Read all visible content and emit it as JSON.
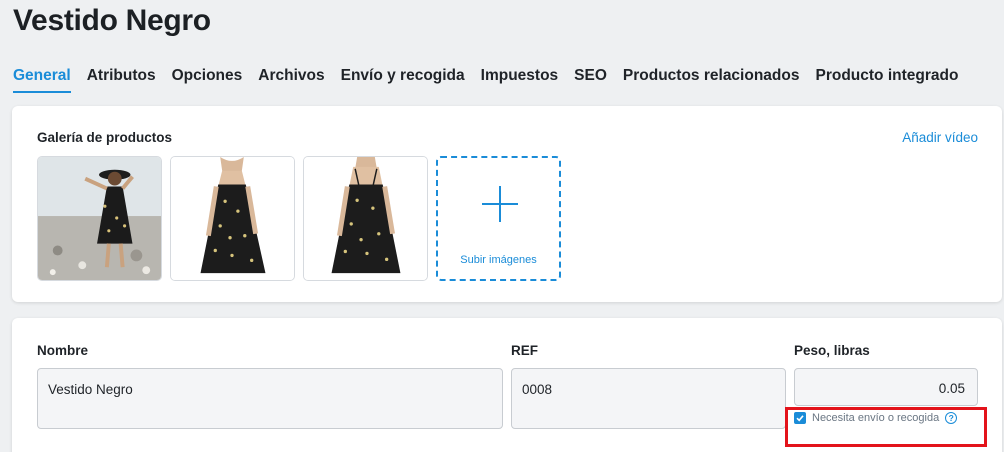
{
  "page": {
    "title": "Vestido Negro"
  },
  "tabs": [
    {
      "label": "General",
      "active": true
    },
    {
      "label": "Atributos"
    },
    {
      "label": "Opciones"
    },
    {
      "label": "Archivos"
    },
    {
      "label": "Envío y recogida"
    },
    {
      "label": "Impuestos"
    },
    {
      "label": "SEO"
    },
    {
      "label": "Productos relacionados"
    },
    {
      "label": "Producto integrado"
    }
  ],
  "gallery": {
    "title": "Galería de productos",
    "add_video": "Añadir vídeo",
    "upload_label": "Subir imágenes"
  },
  "fields": {
    "name": {
      "label": "Nombre",
      "value": "Vestido Negro"
    },
    "ref": {
      "label": "REF",
      "value": "0008"
    },
    "weight": {
      "label": "Peso, libras",
      "value": "0.05"
    }
  },
  "shipping": {
    "label": "Necesita envío o recogida",
    "checked": true
  },
  "colors": {
    "accent": "#1a8cd8",
    "highlight": "#e3131b"
  }
}
